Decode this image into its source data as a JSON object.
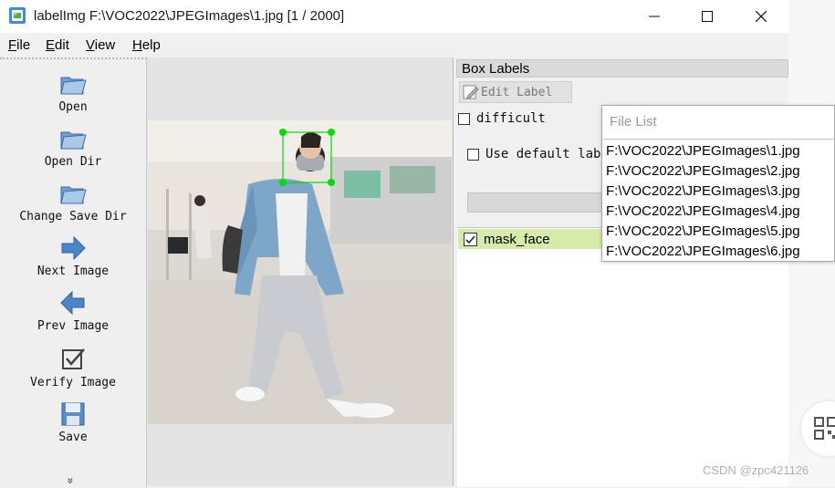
{
  "window": {
    "title": "labelImg F:\\VOC2022\\JPEGImages\\1.jpg [1 / 2000]"
  },
  "menu": [
    "File",
    "Edit",
    "View",
    "Help"
  ],
  "toolbar": {
    "open": "Open",
    "open_dir": "Open Dir",
    "change_save_dir": "Change Save Dir",
    "next_image": "Next Image",
    "prev_image": "Prev Image",
    "verify_image": "Verify Image",
    "save": "Save",
    "more": "»"
  },
  "box_labels": {
    "title": "Box Labels",
    "edit_label": "Edit Label",
    "difficult": "difficult",
    "difficult_checked": false,
    "use_default_label": "Use default label",
    "use_default_checked": false,
    "labels": [
      {
        "text": "mask_face",
        "checked": true
      }
    ]
  },
  "file_list": {
    "title": "File List",
    "items": [
      "F:\\VOC2022\\JPEGImages\\1.jpg",
      "F:\\VOC2022\\JPEGImages\\2.jpg",
      "F:\\VOC2022\\JPEGImages\\3.jpg",
      "F:\\VOC2022\\JPEGImages\\4.jpg",
      "F:\\VOC2022\\JPEGImages\\5.jpg",
      "F:\\VOC2022\\JPEGImages\\6.jpg"
    ]
  },
  "watermark": "CSDN @zpc421126",
  "colors": {
    "bbox": "#00dd00",
    "label_row_bg": "#d6ebaa",
    "icon_blue": "#4a86c8"
  }
}
